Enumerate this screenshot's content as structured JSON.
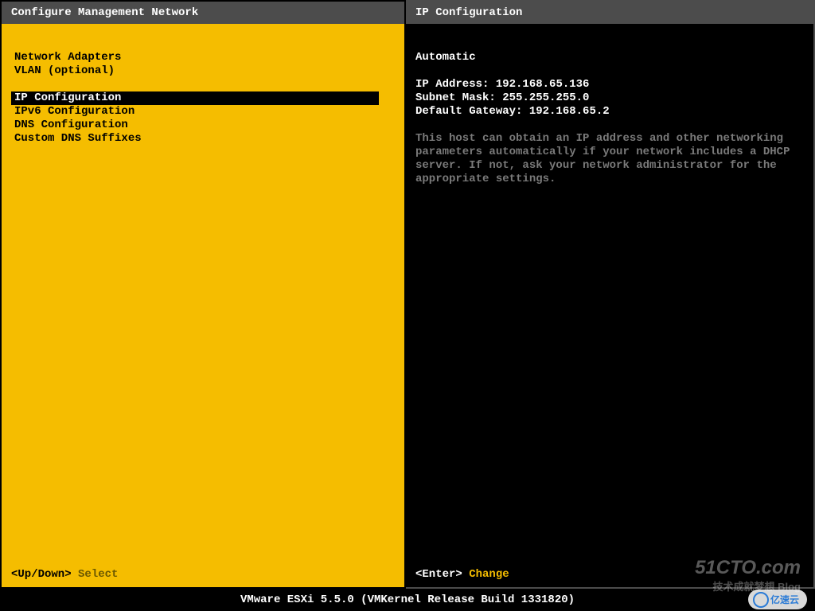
{
  "left": {
    "title": "Configure Management Network",
    "group1": [
      "Network Adapters",
      "VLAN (optional)"
    ],
    "group2": [
      "IP Configuration",
      "IPv6 Configuration",
      "DNS Configuration",
      "Custom DNS Suffixes"
    ],
    "selected_index": 0,
    "footer_key": "<Up/Down>",
    "footer_action": "Select"
  },
  "right": {
    "title": "IP Configuration",
    "mode": "Automatic",
    "ip_label": "IP Address:",
    "ip_value": "192.168.65.136",
    "mask_label": "Subnet Mask:",
    "mask_value": "255.255.255.0",
    "gw_label": "Default Gateway:",
    "gw_value": "192.168.65.2",
    "help": "This host can obtain an IP address and other networking parameters automatically if your network includes a DHCP server. If not, ask your network administrator for the appropriate settings.",
    "footer_key": "<Enter>",
    "footer_action": "Change"
  },
  "status_bar": "VMware ESXi 5.5.0 (VMKernel Release Build 1331820)",
  "watermarks": {
    "w1": "51CTO.com",
    "w1_sub": "技术成就梦想 Blog",
    "w2": "亿速云"
  }
}
